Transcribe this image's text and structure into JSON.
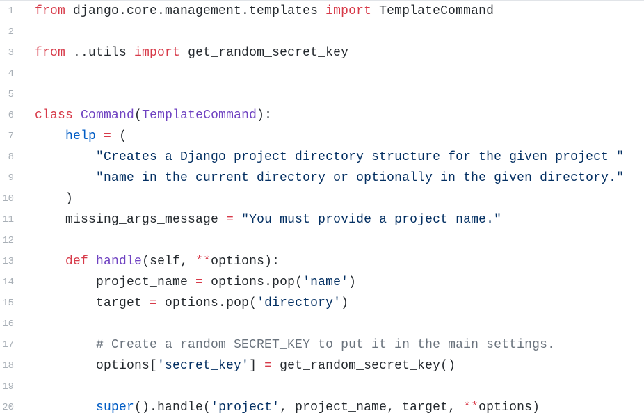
{
  "lines": [
    {
      "num": "1",
      "tokens": [
        {
          "t": "from",
          "c": "kw"
        },
        {
          "t": " django.core.management.templates ",
          "c": "plain"
        },
        {
          "t": "import",
          "c": "kw"
        },
        {
          "t": " TemplateCommand",
          "c": "plain"
        }
      ]
    },
    {
      "num": "2",
      "tokens": []
    },
    {
      "num": "3",
      "tokens": [
        {
          "t": "from",
          "c": "kw"
        },
        {
          "t": " ..utils ",
          "c": "plain"
        },
        {
          "t": "import",
          "c": "kw"
        },
        {
          "t": " get_random_secret_key",
          "c": "plain"
        }
      ]
    },
    {
      "num": "4",
      "tokens": []
    },
    {
      "num": "5",
      "tokens": []
    },
    {
      "num": "6",
      "tokens": [
        {
          "t": "class",
          "c": "kw"
        },
        {
          "t": " ",
          "c": "plain"
        },
        {
          "t": "Command",
          "c": "name"
        },
        {
          "t": "(",
          "c": "plain"
        },
        {
          "t": "TemplateCommand",
          "c": "name"
        },
        {
          "t": "):",
          "c": "plain"
        }
      ]
    },
    {
      "num": "7",
      "tokens": [
        {
          "t": "    ",
          "c": "plain"
        },
        {
          "t": "help",
          "c": "blue"
        },
        {
          "t": " ",
          "c": "plain"
        },
        {
          "t": "=",
          "c": "op"
        },
        {
          "t": " (",
          "c": "plain"
        }
      ]
    },
    {
      "num": "8",
      "tokens": [
        {
          "t": "        ",
          "c": "plain"
        },
        {
          "t": "\"Creates a Django project directory structure for the given project \"",
          "c": "str"
        }
      ]
    },
    {
      "num": "9",
      "tokens": [
        {
          "t": "        ",
          "c": "plain"
        },
        {
          "t": "\"name in the current directory or optionally in the given directory.\"",
          "c": "str"
        }
      ]
    },
    {
      "num": "10",
      "tokens": [
        {
          "t": "    )",
          "c": "plain"
        }
      ]
    },
    {
      "num": "11",
      "tokens": [
        {
          "t": "    missing_args_message ",
          "c": "plain"
        },
        {
          "t": "=",
          "c": "op"
        },
        {
          "t": " ",
          "c": "plain"
        },
        {
          "t": "\"You must provide a project name.\"",
          "c": "str"
        }
      ]
    },
    {
      "num": "12",
      "tokens": []
    },
    {
      "num": "13",
      "tokens": [
        {
          "t": "    ",
          "c": "plain"
        },
        {
          "t": "def",
          "c": "kw"
        },
        {
          "t": " ",
          "c": "plain"
        },
        {
          "t": "handle",
          "c": "name"
        },
        {
          "t": "(self, ",
          "c": "plain"
        },
        {
          "t": "**",
          "c": "op"
        },
        {
          "t": "options):",
          "c": "plain"
        }
      ]
    },
    {
      "num": "14",
      "tokens": [
        {
          "t": "        project_name ",
          "c": "plain"
        },
        {
          "t": "=",
          "c": "op"
        },
        {
          "t": " options.pop(",
          "c": "plain"
        },
        {
          "t": "'name'",
          "c": "str"
        },
        {
          "t": ")",
          "c": "plain"
        }
      ]
    },
    {
      "num": "15",
      "tokens": [
        {
          "t": "        target ",
          "c": "plain"
        },
        {
          "t": "=",
          "c": "op"
        },
        {
          "t": " options.pop(",
          "c": "plain"
        },
        {
          "t": "'directory'",
          "c": "str"
        },
        {
          "t": ")",
          "c": "plain"
        }
      ]
    },
    {
      "num": "16",
      "tokens": []
    },
    {
      "num": "17",
      "tokens": [
        {
          "t": "        ",
          "c": "plain"
        },
        {
          "t": "# Create a random SECRET_KEY to put it in the main settings.",
          "c": "cmt"
        }
      ]
    },
    {
      "num": "18",
      "tokens": [
        {
          "t": "        options[",
          "c": "plain"
        },
        {
          "t": "'secret_key'",
          "c": "str"
        },
        {
          "t": "] ",
          "c": "plain"
        },
        {
          "t": "=",
          "c": "op"
        },
        {
          "t": " get_random_secret_key()",
          "c": "plain"
        }
      ]
    },
    {
      "num": "19",
      "tokens": []
    },
    {
      "num": "20",
      "tokens": [
        {
          "t": "        ",
          "c": "plain"
        },
        {
          "t": "super",
          "c": "blue"
        },
        {
          "t": "().handle(",
          "c": "plain"
        },
        {
          "t": "'project'",
          "c": "str"
        },
        {
          "t": ", project_name, target, ",
          "c": "plain"
        },
        {
          "t": "**",
          "c": "op"
        },
        {
          "t": "options)",
          "c": "plain"
        }
      ]
    }
  ]
}
